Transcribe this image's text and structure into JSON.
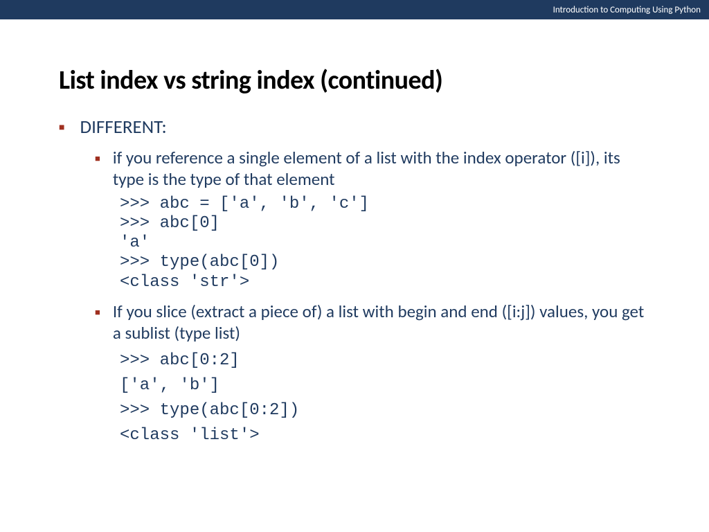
{
  "header": {
    "course_label": "Introduction to Computing Using Python"
  },
  "title": "List index vs string index (continued)",
  "bullets": {
    "level1_text": "DIFFERENT:",
    "sub1_text": "if you reference a single element of a list with the index operator ([i]), its type is the type of that element",
    "sub2_text": "If you slice (extract a piece of) a list with begin and end ([i:j]) values, you get a sublist (type list)"
  },
  "code1": {
    "line1": ">>> abc = ['a', 'b', 'c']",
    "line2": ">>> abc[0]",
    "line3": "'a'",
    "line4": ">>> type(abc[0])",
    "line5": "<class 'str'>"
  },
  "code2": {
    "line1": ">>> abc[0:2]",
    "line2": "['a', 'b']",
    "line3": ">>> type(abc[0:2])",
    "line4": "<class 'list'>"
  }
}
